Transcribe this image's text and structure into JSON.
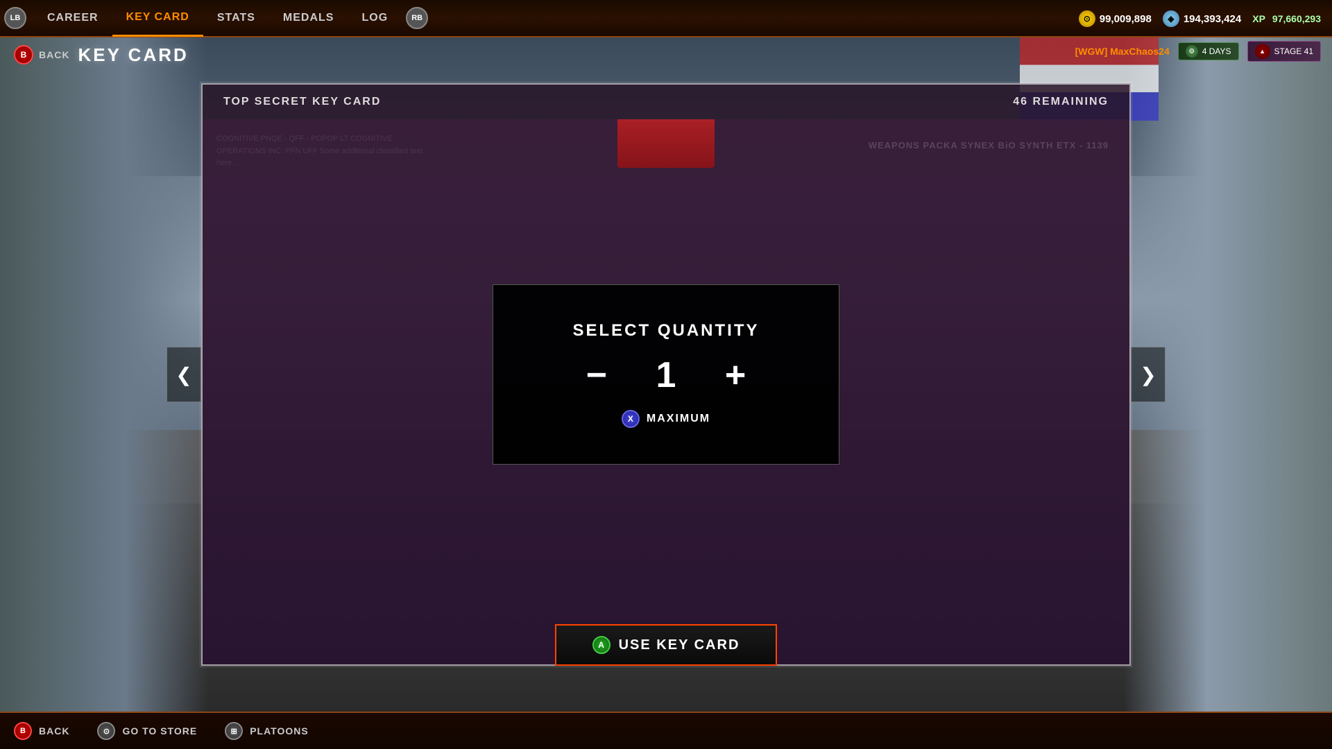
{
  "nav": {
    "lb_button": "LB",
    "rb_button": "RB",
    "items": [
      {
        "label": "CAREER",
        "active": false
      },
      {
        "label": "KEY CARD",
        "active": true
      },
      {
        "label": "STATS",
        "active": false
      },
      {
        "label": "MEDALS",
        "active": false
      },
      {
        "label": "LOG",
        "active": false
      }
    ]
  },
  "currency": {
    "coin_icon": "⊙",
    "coin_value": "99,009,898",
    "gem_icon": "◈",
    "gem_value": "194,393,424",
    "xp_label": "XP",
    "xp_value": "97,660,293"
  },
  "user": {
    "name": "[WGW] MaxChaos24",
    "days_icon": "⚙",
    "days_label": "4 DAYS",
    "stage_label": "STAGE 41"
  },
  "page": {
    "back_button": "B",
    "back_label": "BACK",
    "title": "KEY CARD"
  },
  "card": {
    "title": "TOP SECRET KEY CARD",
    "remaining": "46 REMAINING",
    "bg_text": "COGNITIVE PNQE - QFF - POPOP LT\nCOGNITIVE OPERATIONS INC. PFN UFF\nSome additional classified text here...",
    "weapons_text": "WEAPONS PACKA\nSYNEX BiO SYNTH ETX - 1139"
  },
  "quantity_modal": {
    "title": "SELECT QUANTITY",
    "value": "1",
    "minus_btn": "−",
    "plus_btn": "+",
    "x_button": "X",
    "maximum_label": "MAXIMUM"
  },
  "nav_arrows": {
    "left": "❮",
    "right": "❯"
  },
  "use_keycard": {
    "a_button": "A",
    "label": "USE KEY CARD"
  },
  "bottom_bar": {
    "back_btn": "B",
    "back_label": "BACK",
    "store_btn": "⊙",
    "store_label": "GO TO STORE",
    "platoon_icon": "⊞",
    "platoon_label": "PLATOONS"
  }
}
